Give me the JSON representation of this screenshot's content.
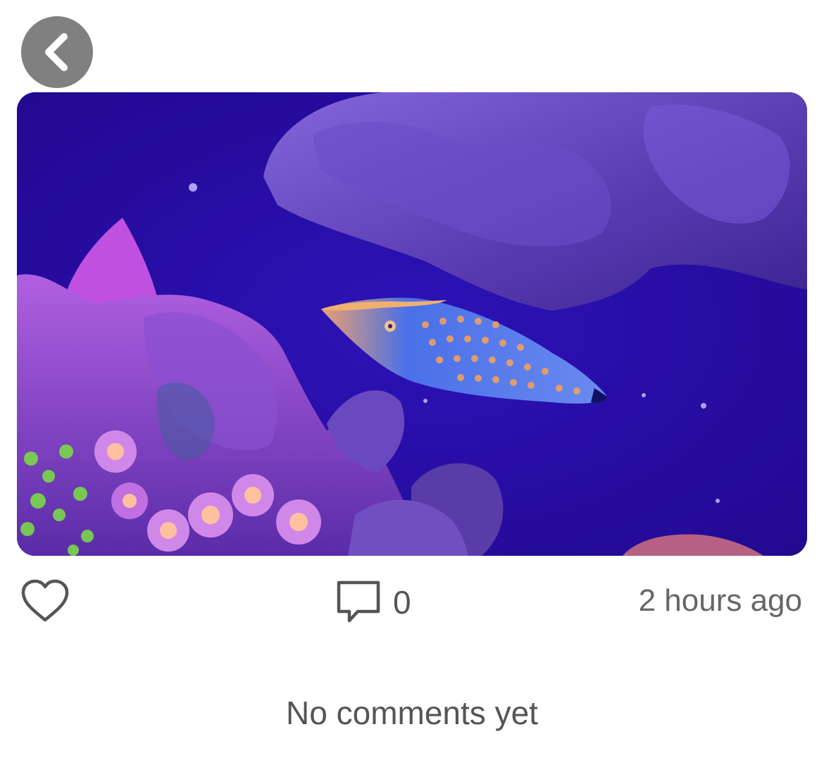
{
  "nav": {
    "back_icon": "chevron-left-icon"
  },
  "post": {
    "photo_alt": "",
    "like_icon": "heart-outline-icon",
    "comment_icon": "speech-bubble-icon",
    "comment_count": "0",
    "timestamp": "2 hours ago"
  },
  "comments": {
    "empty_message": "No comments yet"
  },
  "colors": {
    "back_button_bg": "#808080",
    "icon_stroke": "#555555",
    "text_secondary": "#666666",
    "photo_water": "#2a0fa0"
  }
}
